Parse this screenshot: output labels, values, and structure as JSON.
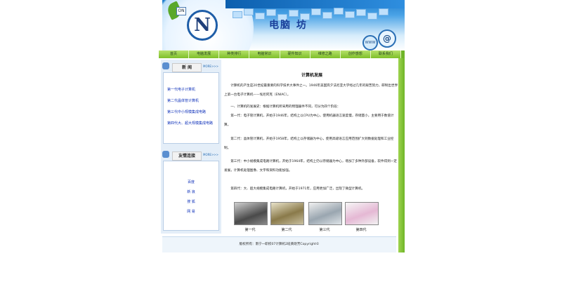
{
  "banner": {
    "title": "电脑 坊",
    "on_label": "ON",
    "logo_letter": "N",
    "globe_symbol": "@",
    "www": "WWW"
  },
  "nav": [
    "首页",
    "电脑发展",
    "种类排行",
    "电脑常识",
    "硬件知识",
    "维修之路",
    "创作感想",
    "联系我们"
  ],
  "sidebar": {
    "news": {
      "title": "新 闻",
      "more": "MORE>>>",
      "items": [
        "第一代电子计算机",
        "第二代晶体管计算机",
        "第三代中小规模集成电路",
        "第四代大、超大规模集成电路"
      ]
    },
    "links": {
      "title": "友情连接",
      "more": "MORE>>>",
      "items": [
        "百度",
        "新 浪",
        "搜 狐",
        "网 易"
      ]
    }
  },
  "main": {
    "title": "计算机发展",
    "paragraphs": [
      "　　计算机的产生是20世纪最重要的科学技术大事件之一。1946年美国宾夕法尼亚大学经过几年的艰苦努力，研制出世界上第一台电子计算机——埃尼阿克（ENIAC）。",
      "　　一、计算机的发展史：根据计算机所采用的物理器件不同，可分为四个阶段：",
      "　　第一代：电子管计算机，开始于1946年，结构上以CPU为中心，使用机器语言速度慢，存储量小，主要用于数值计算。",
      "　　第二代：晶体管计算机，开始于1958年，结构上以存储器为中心，使用高级语言应用范围扩大到数据处理和工业控制。",
      "　　第三代：中小规模集成电路计算机，开始于1964年，结构上仍以存储器为中心，增加了多种外部设备，软件得到一定发展，计算机处理图像、文字和资料功能加强。",
      "　　第四代：大、超大规模集成电路计算机，开始于1971年，应用更加广泛，出现了微型计算机。"
    ],
    "captions": [
      "第一代",
      "第二代",
      "第三代",
      "第四代"
    ]
  },
  "footer": {
    "text": "版权所有：南宁一职校07计算机2班黄晓芳Copyright©"
  },
  "colors": {
    "nav_green": "#8fcb3a",
    "banner_blue": "#1e7ccd",
    "link_blue": "#1133bb"
  }
}
